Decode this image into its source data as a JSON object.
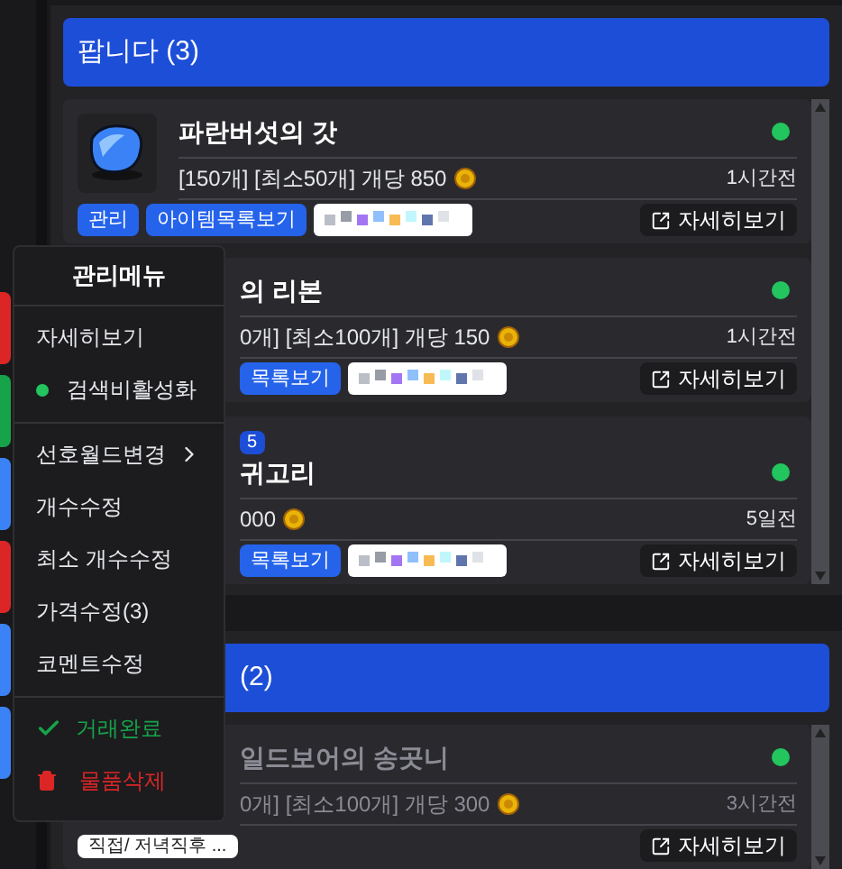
{
  "side_markers": [
    {
      "color": "#dc2626"
    },
    {
      "color": "#16a34a"
    },
    {
      "color": "#3b82f6"
    },
    {
      "color": "#dc2626"
    },
    {
      "color": "#3b82f6"
    },
    {
      "color": "#3b82f6"
    }
  ],
  "sections": [
    {
      "title": "팝니다 (3)",
      "cards": [
        {
          "thumbnail": true,
          "title": "파란버섯의 갓",
          "online": true,
          "dimmed": false,
          "details": "[150개] [최소50개] 개당 850",
          "time": "1시간전",
          "bottom": [
            {
              "kind": "button",
              "label": "관리"
            },
            {
              "kind": "button",
              "label": "아이템목록보기"
            },
            {
              "kind": "blurred"
            }
          ],
          "detail_button": "자세히보기"
        },
        {
          "title": "의 리본",
          "online": true,
          "dimmed": false,
          "details": "0개] [최소100개] 개당 150",
          "time": "1시간전",
          "bottom": [
            {
              "kind": "button",
              "label": "목록보기"
            },
            {
              "kind": "blurred"
            }
          ],
          "detail_button": "자세히보기"
        },
        {
          "badge": "5",
          "title": "귀고리",
          "online": true,
          "dimmed": false,
          "details": "000",
          "time": "5일전",
          "bottom": [
            {
              "kind": "button",
              "label": "목록보기"
            },
            {
              "kind": "blurred"
            }
          ],
          "detail_button": "자세히보기"
        }
      ]
    },
    {
      "title": "(2)",
      "cards": [
        {
          "title": "일드보어의 송곳니",
          "online": true,
          "dimmed": true,
          "details": "0개] [최소100개] 개당 300",
          "time": "3시간전",
          "bottom": [
            {
              "kind": "note",
              "label": "직접/ 저녁직후 ..."
            }
          ],
          "detail_button": "자세히보기"
        }
      ]
    }
  ],
  "menu": {
    "title": "관리메뉴",
    "groups": [
      [
        {
          "kind": "plain",
          "label": "자세히보기"
        },
        {
          "kind": "dot",
          "label": "검색비활성화"
        }
      ],
      [
        {
          "kind": "submenu",
          "label": "선호월드변경"
        },
        {
          "kind": "plain",
          "label": "개수수정"
        },
        {
          "kind": "plain",
          "label": "최소 개수수정"
        },
        {
          "kind": "plain",
          "label": "가격수정(3)"
        },
        {
          "kind": "plain",
          "label": "코멘트수정"
        }
      ],
      [
        {
          "kind": "success",
          "label": "거래완료"
        },
        {
          "kind": "danger",
          "label": "물품삭제"
        }
      ]
    ]
  }
}
